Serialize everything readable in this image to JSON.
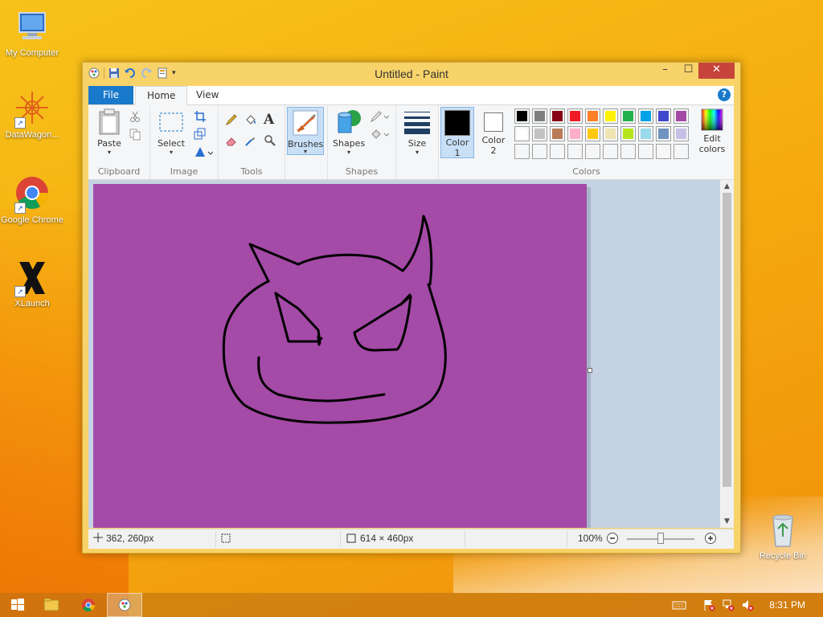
{
  "desktop": {
    "icons": [
      {
        "label": "My Computer"
      },
      {
        "label": "DataWagon..."
      },
      {
        "label": "Google Chrome"
      },
      {
        "label": "XLaunch"
      },
      {
        "label": "Recycle Bin"
      }
    ]
  },
  "window": {
    "title": "Untitled - Paint",
    "controls": {
      "minimize": "–",
      "maximize": "☐",
      "close": "✕"
    }
  },
  "ribbon": {
    "tabs": [
      {
        "label": "File"
      },
      {
        "label": "Home"
      },
      {
        "label": "View"
      }
    ],
    "help_label": "?",
    "groups": {
      "clipboard": {
        "label": "Clipboard",
        "paste": "Paste"
      },
      "image": {
        "label": "Image",
        "select": "Select"
      },
      "tools": {
        "label": "Tools",
        "text_tool": "A"
      },
      "brushes": {
        "label": "Brushes"
      },
      "shapes": {
        "label": "Shapes",
        "shapes_btn": "Shapes"
      },
      "size": {
        "label": "Size"
      },
      "colors": {
        "label": "Colors",
        "color1": "Color\n1",
        "color1_line1": "Color",
        "color1_line2": "1",
        "color2_line1": "Color",
        "color2_line2": "2",
        "edit_line1": "Edit",
        "edit_line2": "colors",
        "color1_value": "#000000",
        "color2_value": "#ffffff",
        "palette_row1": [
          "#000000",
          "#7f7f7f",
          "#880015",
          "#ed1c24",
          "#ff7f27",
          "#fff200",
          "#22b14c",
          "#00a2e8",
          "#3f48cc",
          "#a349a4"
        ],
        "palette_row2": [
          "#ffffff",
          "#c3c3c3",
          "#b97a57",
          "#ffaec9",
          "#ffc90e",
          "#efe4b0",
          "#b5e61d",
          "#99d9ea",
          "#7092be",
          "#c8bfe7"
        ]
      }
    }
  },
  "canvas": {
    "background": "#a44aa7",
    "stroke_color": "#000000"
  },
  "status": {
    "cursor_pos": "362, 260px",
    "image_size": "614 × 460px",
    "zoom": "100%"
  },
  "taskbar": {
    "clock": "8:31 PM"
  }
}
